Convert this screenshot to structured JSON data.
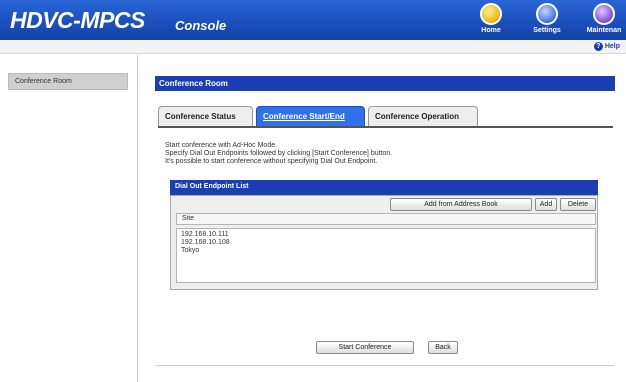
{
  "header": {
    "brand": "HDVC-MPCS",
    "subtitle": "Console",
    "icons": [
      {
        "name": "home-icon",
        "label": "Home"
      },
      {
        "name": "settings-icon",
        "label": "Settings"
      },
      {
        "name": "maintenance-icon",
        "label": "Maintenan"
      }
    ],
    "help_label": "Help"
  },
  "sidebar": {
    "items": [
      {
        "label": "Conference Room",
        "selected": true
      }
    ]
  },
  "main": {
    "panel_title": "Conference Room",
    "tabs": [
      {
        "label": "Conference Status",
        "active": false
      },
      {
        "label": "Conference Start/End",
        "active": true
      },
      {
        "label": "Conference Operation",
        "active": false
      }
    ],
    "description": [
      "Start conference with Ad-Hoc Mode.",
      "Specify Dial Out Endpoints followed by clicking [Start Conference] button.",
      "It's possible to start conference without specifying Dial Out Endpoint."
    ],
    "dial_out": {
      "title": "Dial Out Endpoint List",
      "add_from_address_book": "Add from Address Book",
      "add": "Add",
      "delete": "Delete",
      "column_site": "Site",
      "sites": [
        "192.168.10.111",
        "192.168.10.108",
        "Tokyo"
      ]
    },
    "start_conference": "Start Conference",
    "back": "Back"
  },
  "colors": {
    "header_blue": "#1b50bd",
    "panel_blue": "#1a3fb4",
    "active_tab": "#3170e8"
  }
}
